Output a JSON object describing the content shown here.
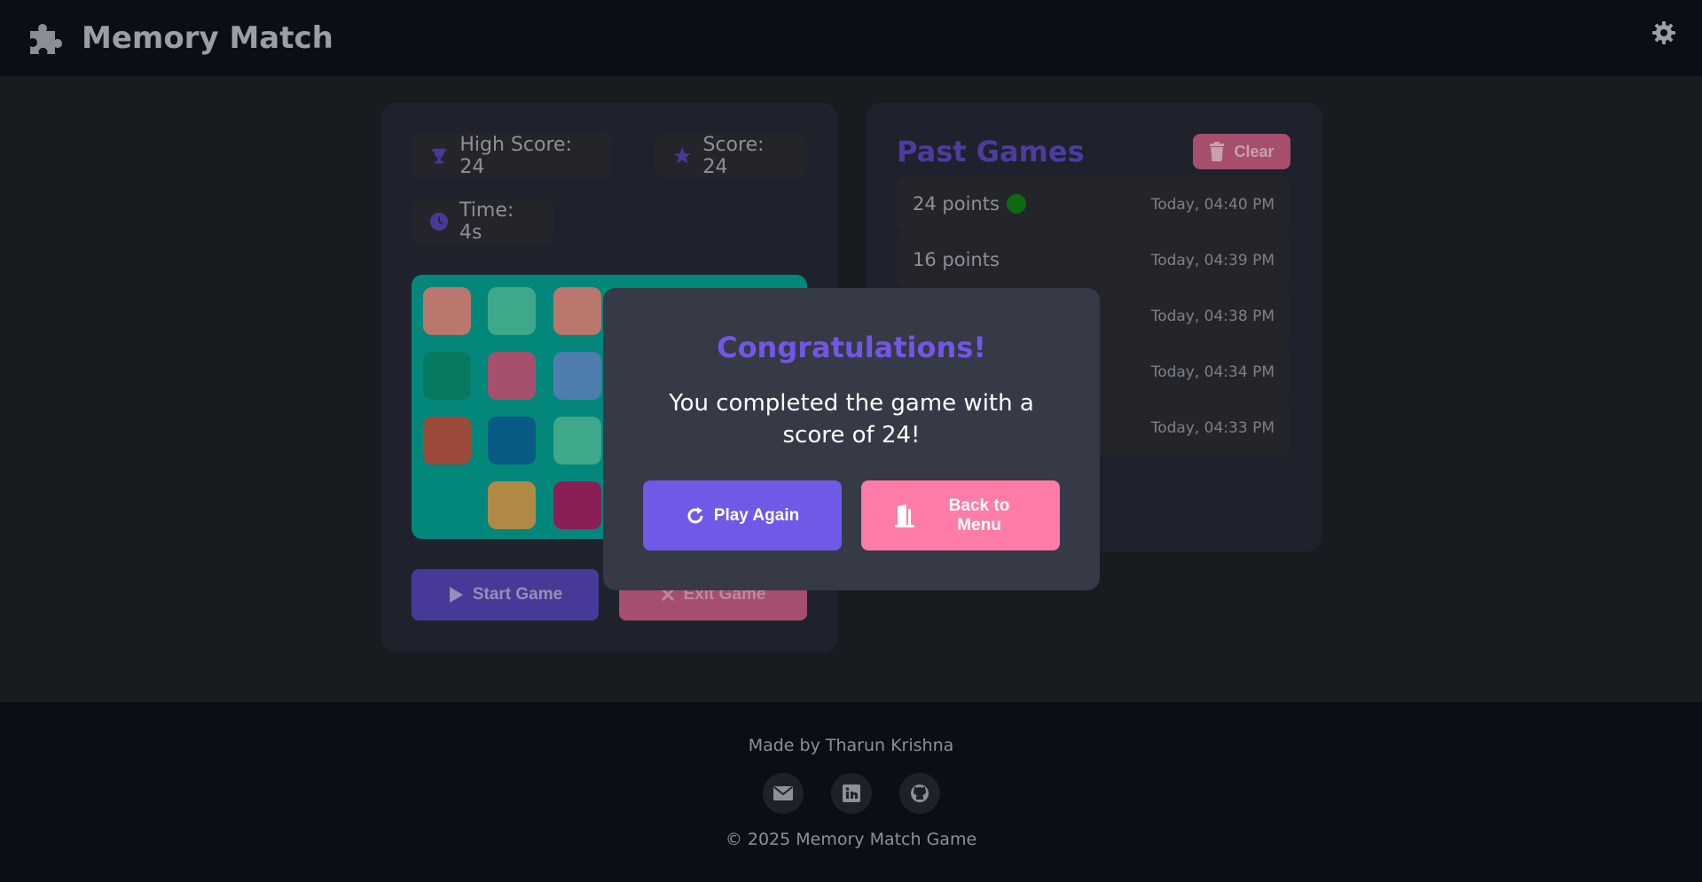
{
  "header": {
    "title": "Memory Match",
    "logo_icon": "puzzle-icon",
    "settings_icon": "gear-icon"
  },
  "stats": {
    "high_score": "High Score: 24",
    "score": "Score: 24",
    "time": "Time: 4s"
  },
  "board": {
    "color": "#03877b",
    "cards_visible": [
      "#b9776e",
      "#3fa88a",
      "#b9776e",
      "#057a61",
      "#a6506d",
      "#4f7eae",
      "#9c4a3a",
      "#0a5a86",
      "#3fa88a",
      "",
      "#b08a44",
      "#8a1f56"
    ]
  },
  "controls": {
    "start_label": "Start Game",
    "exit_label": "Exit Game"
  },
  "history": {
    "title": "Past Games",
    "clear_label": "Clear",
    "entries": [
      {
        "points": "24 points",
        "time": "Today, 04:40 PM",
        "new": true
      },
      {
        "points": "16 points",
        "time": "Today, 04:39 PM"
      },
      {
        "points": "",
        "time": "Today, 04:38 PM"
      },
      {
        "points": "",
        "time": "Today, 04:34 PM"
      },
      {
        "points": "",
        "time": "Today, 04:33 PM"
      }
    ]
  },
  "modal": {
    "title": "Congratulations!",
    "message": "You completed the game with a score of 24!",
    "play_again_label": "Play Again",
    "back_to_menu_label": "Back to Menu"
  },
  "footer": {
    "credit": "Made by Tharun Krishna",
    "copyright": "© 2025 Memory Match Game",
    "social_icons": [
      "email-icon",
      "linkedin-icon",
      "github-icon"
    ]
  },
  "colors": {
    "accent": "#7059e6",
    "danger": "#ff7ba8",
    "background": "#181c21"
  }
}
